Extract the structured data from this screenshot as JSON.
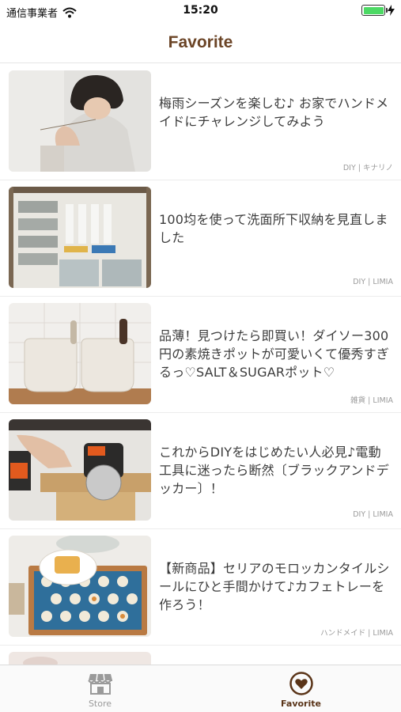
{
  "status_bar": {
    "carrier": "通信事業者",
    "time": "15:20"
  },
  "header": {
    "title": "Favorite"
  },
  "articles": [
    {
      "title": "梅雨シーズンを楽しむ♪ お家でハンドメイドにチャレンジしてみよう",
      "meta": "DIY | キナリノ"
    },
    {
      "title": "100均を使って洗面所下収納を見直しました",
      "meta": "DIY | LIMIA"
    },
    {
      "title": "品薄！見つけたら即買い！ダイソー300円の素焼きポットが可愛いくて優秀すぎるっ♡SALT＆SUGARポット♡",
      "meta": "雑貨 | LIMIA"
    },
    {
      "title": "これからDIYをはじめたい人必見♪電動工具に迷ったら断然〔ブラックアンドデッカー〕！",
      "meta": "DIY | LIMIA"
    },
    {
      "title": "【新商品】セリアのモロッカンタイルシールにひと手間かけて♪カフェトレーを作ろう！",
      "meta": "ハンドメイド | LIMIA"
    }
  ],
  "tabs": [
    {
      "label": "Store",
      "icon": "store-icon",
      "active": false
    },
    {
      "label": "Favorite",
      "icon": "heart-icon",
      "active": true
    }
  ],
  "colors": {
    "accent": "#5a3418",
    "title": "#6b4426",
    "inactive": "#9a9a9a",
    "battery": "#4cd964"
  }
}
